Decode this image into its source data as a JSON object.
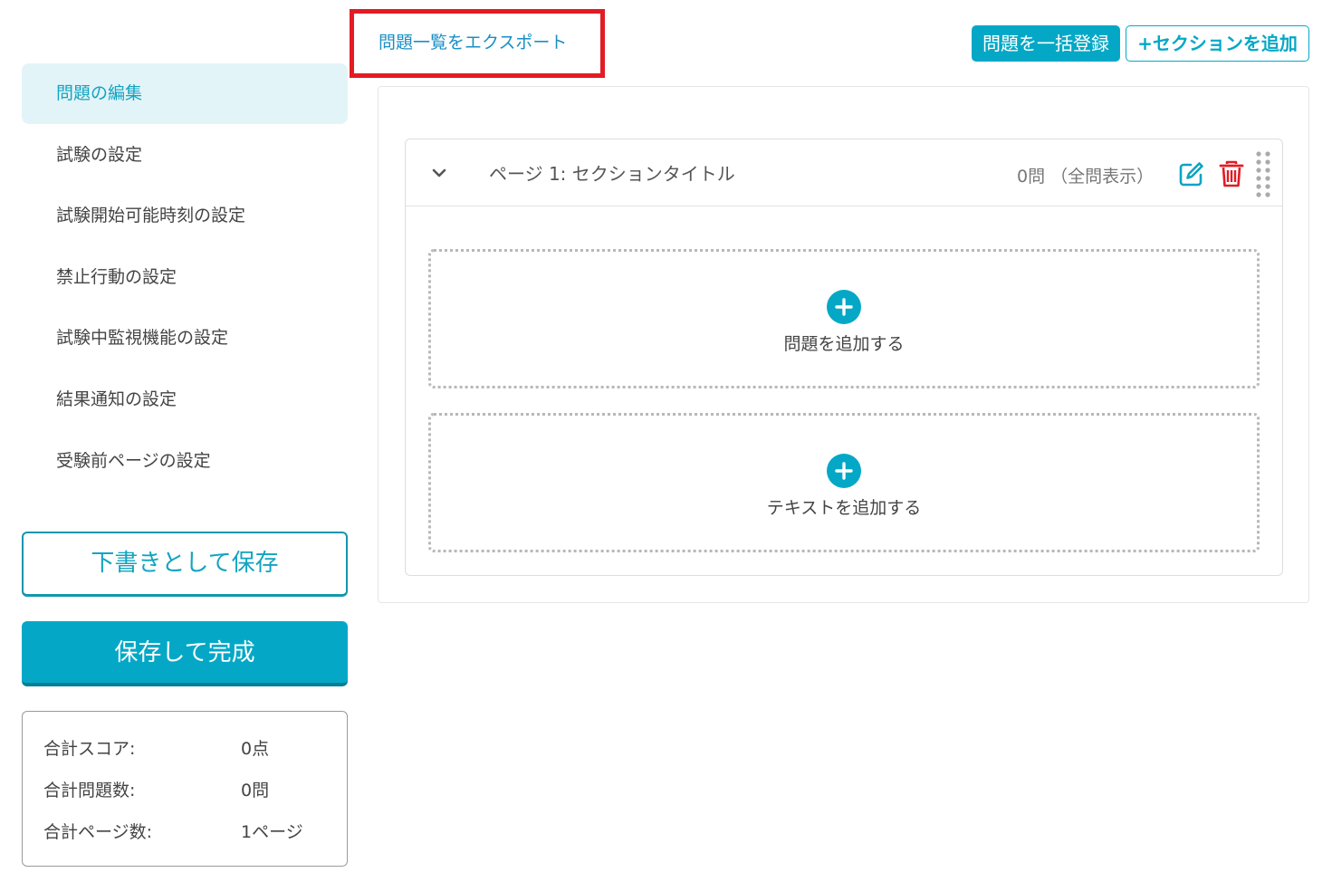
{
  "sidebar": {
    "items": [
      {
        "label": "問題の編集",
        "active": true
      },
      {
        "label": "試験の設定",
        "active": false
      },
      {
        "label": "試験開始可能時刻の設定",
        "active": false
      },
      {
        "label": "禁止行動の設定",
        "active": false
      },
      {
        "label": "試験中監視機能の設定",
        "active": false
      },
      {
        "label": "結果通知の設定",
        "active": false
      },
      {
        "label": "受験前ページの設定",
        "active": false
      }
    ],
    "save_draft_label": "下書きとして保存",
    "save_complete_label": "保存して完成"
  },
  "summary": {
    "rows": [
      {
        "label": "合計スコア:",
        "value": "0点"
      },
      {
        "label": "合計問題数:",
        "value": "0問"
      },
      {
        "label": "合計ページ数:",
        "value": "1ページ"
      }
    ]
  },
  "toolbar": {
    "export_label": "問題一覧をエクスポート",
    "bulk_register_label": "問題を一括登録",
    "add_section_label": "+セクションを追加"
  },
  "section": {
    "title": "ページ 1: セクションタイトル",
    "count": "0問 （全問表示）",
    "add_question_label": "問題を追加する",
    "add_text_label": "テキストを追加する"
  },
  "icons": {
    "chevron": "chevron-down-icon",
    "edit": "edit-icon",
    "delete": "trash-icon",
    "drag": "drag-handle-icon",
    "add": "plus-circle-icon"
  },
  "colors": {
    "accent": "#04a8c6",
    "accent_dark": "#037f96",
    "active_bg": "#e3f4f8",
    "link": "#1a8fc5",
    "danger": "#e31b23",
    "highlight_box": "#e31b23"
  }
}
